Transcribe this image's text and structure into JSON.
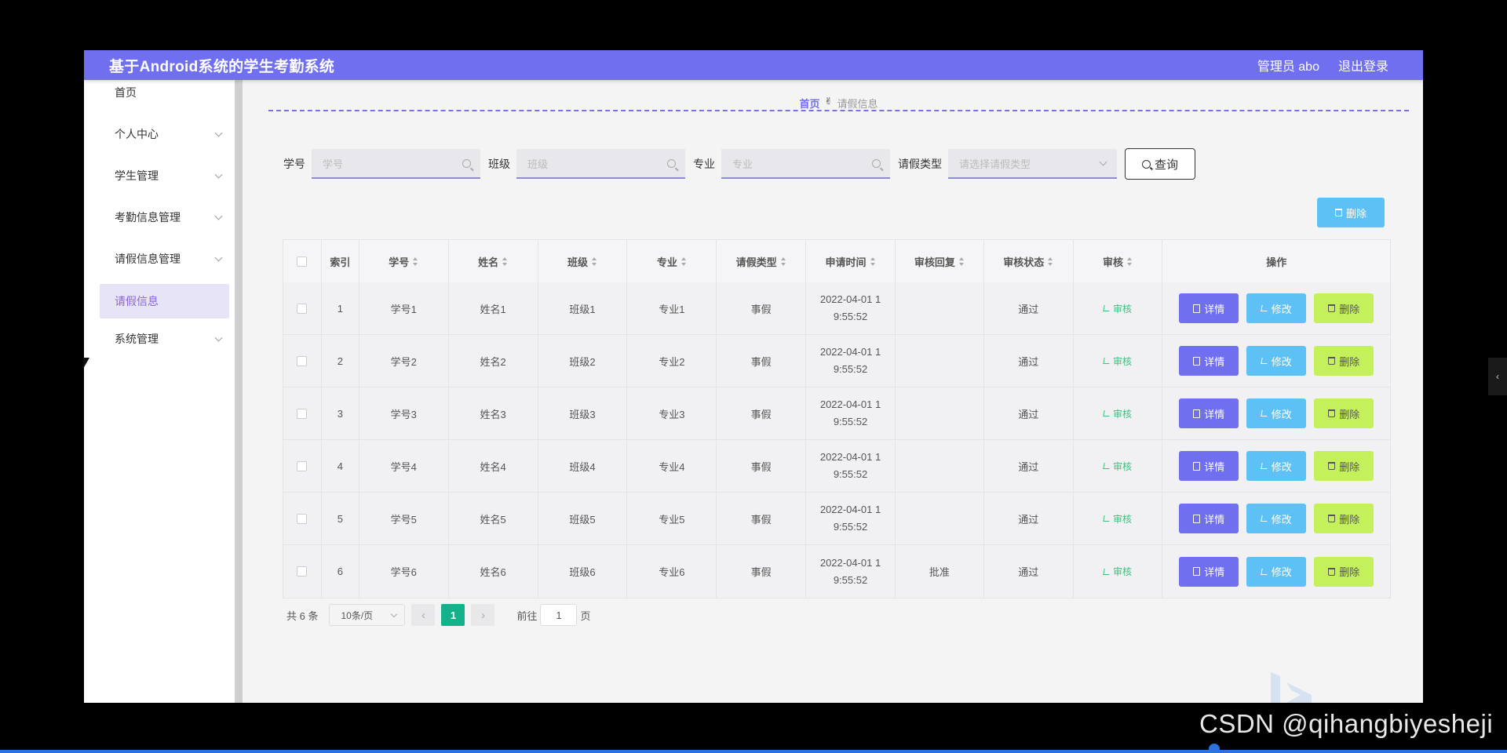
{
  "header": {
    "title": "基于Android系统的学生考勤系统",
    "user": "管理员 abo",
    "logout": "退出登录"
  },
  "sidebar": {
    "items": [
      {
        "label": "首页",
        "chevron": false
      },
      {
        "label": "个人中心",
        "chevron": true
      },
      {
        "label": "学生管理",
        "chevron": true
      },
      {
        "label": "考勤信息管理",
        "chevron": true
      },
      {
        "label": "请假信息管理",
        "chevron": true
      },
      {
        "label": "请假信息",
        "chevron": false,
        "active": true
      },
      {
        "label": "系统管理",
        "chevron": true
      }
    ]
  },
  "breadcrumb": {
    "home": "首页",
    "current": "请假信息"
  },
  "search": {
    "fields": [
      {
        "label": "学号",
        "placeholder": "学号"
      },
      {
        "label": "班级",
        "placeholder": "班级"
      },
      {
        "label": "专业",
        "placeholder": "专业"
      },
      {
        "label": "请假类型",
        "placeholder": "请选择请假类型"
      }
    ],
    "query_label": "查询"
  },
  "bulk_delete_label": "删除",
  "table": {
    "headers": [
      "索引",
      "学号",
      "姓名",
      "班级",
      "专业",
      "请假类型",
      "申请时间",
      "审核回复",
      "审核状态",
      "审核",
      "操作"
    ],
    "rows": [
      {
        "index": "1",
        "xuehao": "学号1",
        "name": "姓名1",
        "class": "班级1",
        "major": "专业1",
        "type": "事假",
        "time1": "2022-04-01 1",
        "time2": "9:55:52",
        "reply": "",
        "status": "通过"
      },
      {
        "index": "2",
        "xuehao": "学号2",
        "name": "姓名2",
        "class": "班级2",
        "major": "专业2",
        "type": "事假",
        "time1": "2022-04-01 1",
        "time2": "9:55:52",
        "reply": "",
        "status": "通过"
      },
      {
        "index": "3",
        "xuehao": "学号3",
        "name": "姓名3",
        "class": "班级3",
        "major": "专业3",
        "type": "事假",
        "time1": "2022-04-01 1",
        "time2": "9:55:52",
        "reply": "",
        "status": "通过"
      },
      {
        "index": "4",
        "xuehao": "学号4",
        "name": "姓名4",
        "class": "班级4",
        "major": "专业4",
        "type": "事假",
        "time1": "2022-04-01 1",
        "time2": "9:55:52",
        "reply": "",
        "status": "通过"
      },
      {
        "index": "5",
        "xuehao": "学号5",
        "name": "姓名5",
        "class": "班级5",
        "major": "专业5",
        "type": "事假",
        "time1": "2022-04-01 1",
        "time2": "9:55:52",
        "reply": "",
        "status": "通过"
      },
      {
        "index": "6",
        "xuehao": "学号6",
        "name": "姓名6",
        "class": "班级6",
        "major": "专业6",
        "type": "事假",
        "time1": "2022-04-01 1",
        "time2": "9:55:52",
        "reply": "批准",
        "status": "通过"
      }
    ],
    "audit_label": "审核",
    "ops": {
      "detail": "详情",
      "edit": "修改",
      "delete": "删除"
    }
  },
  "pager": {
    "total": "共 6 条",
    "page_size": "10条/页",
    "current_page": "1",
    "goto_label": "前往",
    "goto_value": "1",
    "page_unit": "页"
  },
  "watermark": "CSDN @qihangbiyesheji",
  "colors": {
    "brand": "#6f6ff0",
    "edit": "#5ec1f6",
    "delete": "#c4f05c",
    "page_active": "#13b28a"
  }
}
